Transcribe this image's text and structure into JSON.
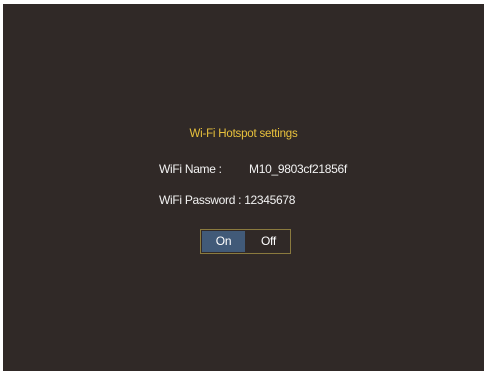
{
  "dialog": {
    "title": "Wi-Fi Hotspot settings",
    "wifi_name_label": "WiFi Name :",
    "wifi_name_value": "M10_9803cf21856f",
    "wifi_password_label": "WiFi Password :",
    "wifi_password_value": "12345678"
  },
  "toggle": {
    "on_label": "On",
    "off_label": "Off",
    "selected": "On"
  },
  "colors": {
    "background": "#302927",
    "title": "#e9c23c",
    "text": "#f2f2f2",
    "selected_option": "#415a78",
    "toggle_border": "#8a7a3e"
  }
}
